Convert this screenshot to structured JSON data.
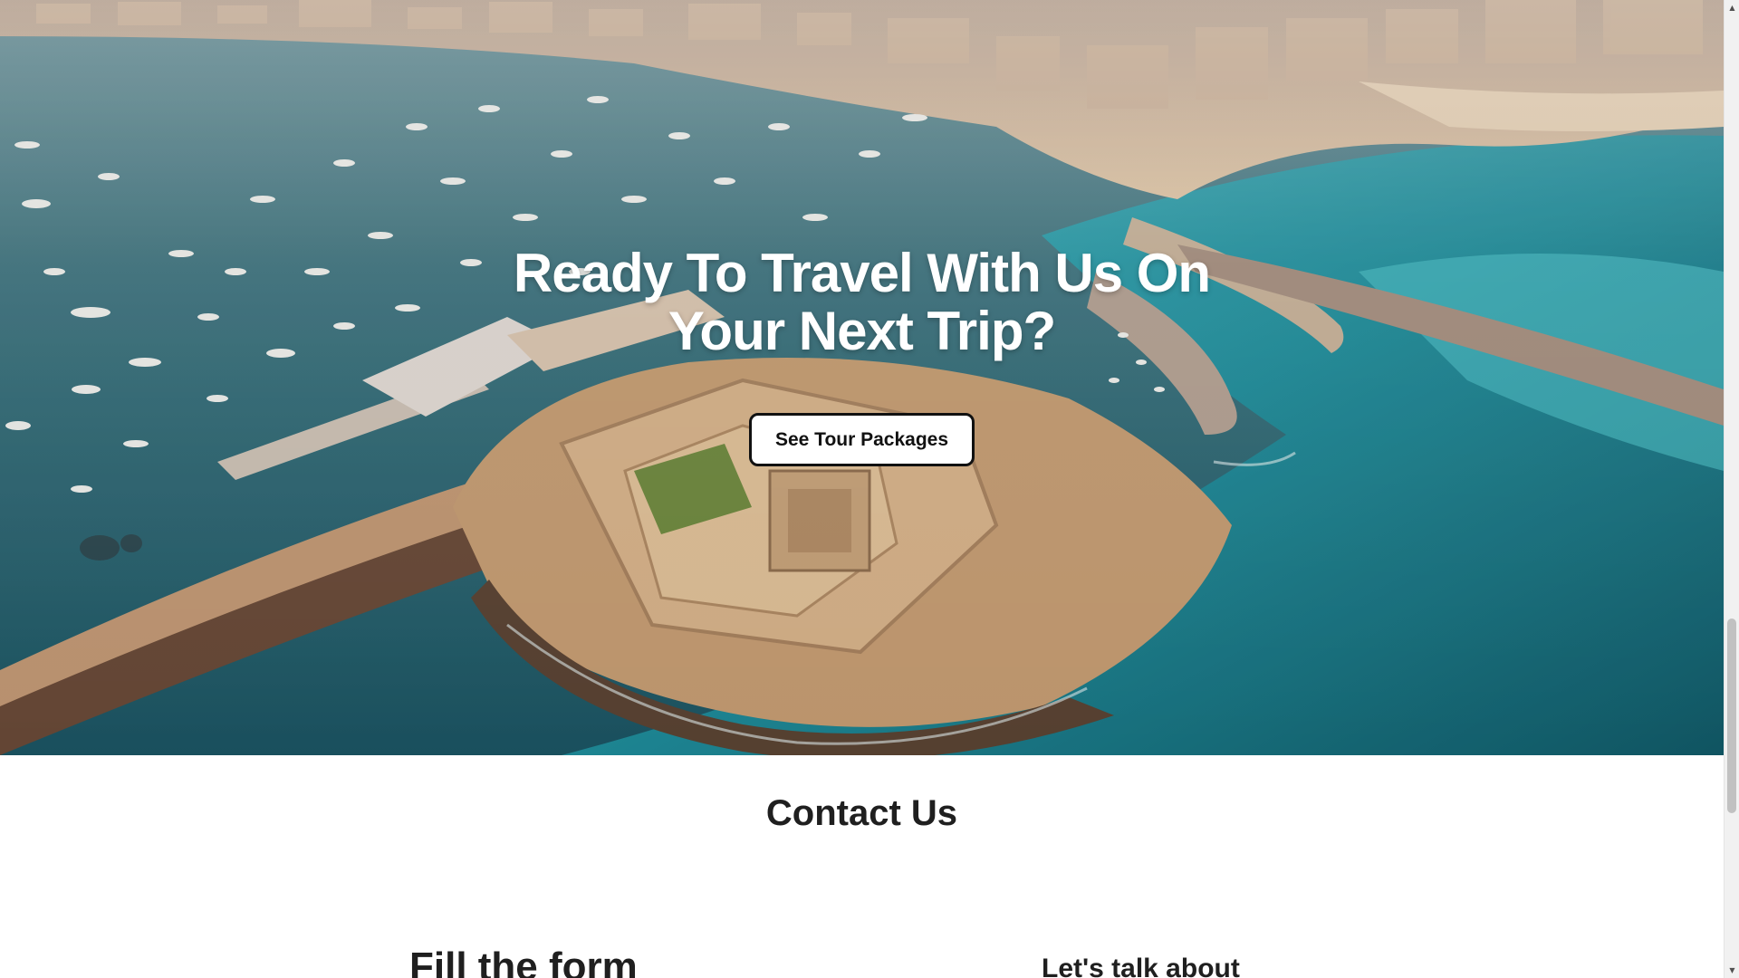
{
  "hero": {
    "title": "Ready To Travel With Us On Your Next Trip?",
    "cta_label": "See Tour Packages",
    "background_image": "aerial-citadel-harbor-photo"
  },
  "contact": {
    "title": "Contact Us",
    "form_heading": "Fill the form",
    "talk_heading": "Let's talk about"
  },
  "colors": {
    "sea_deep": "#1f5f6c",
    "sea_turquoise": "#2aa3b0",
    "stone": "#c9a27a",
    "city": "#d8bfa4",
    "text_dark": "#1f1f1f",
    "button_border": "#111111"
  },
  "scrollbar": {
    "up_icon": "chevron-up-icon",
    "down_icon": "chevron-down-icon"
  }
}
